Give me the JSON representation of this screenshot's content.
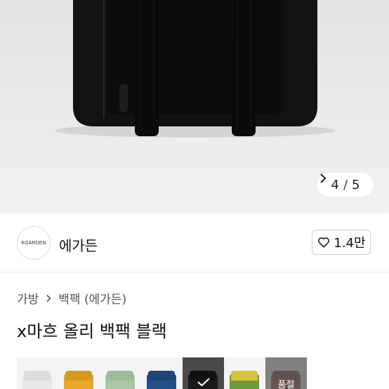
{
  "gallery": {
    "current": "4",
    "separator": "/",
    "total": "5",
    "next_icon": "chevron-right-icon"
  },
  "seller": {
    "logo_text": "EGARDEN",
    "name": "에가든",
    "like_count": "1.4만",
    "like_icon": "heart-outline-icon"
  },
  "breadcrumb": {
    "items": [
      "가방",
      "백팩 (에가든)"
    ],
    "separator_icon": "chevron-right-icon"
  },
  "product": {
    "title": "x마흐 올리 백팩 블랙"
  },
  "swatches": [
    {
      "name": "white",
      "color": "#e8e8e8",
      "flap": "#dcdcdc",
      "selected": false,
      "sold_out": false
    },
    {
      "name": "yellow",
      "color": "#e8a826",
      "flap": "#d49a20",
      "selected": false,
      "sold_out": false
    },
    {
      "name": "mint",
      "color": "#a9c9a6",
      "flap": "#9cbd99",
      "selected": false,
      "sold_out": false
    },
    {
      "name": "navy",
      "color": "#24508a",
      "flap": "#1f4476",
      "selected": false,
      "sold_out": false
    },
    {
      "name": "black",
      "color": "#1a1a1a",
      "flap": "#111111",
      "selected": true,
      "sold_out": false
    },
    {
      "name": "olive",
      "color": "#6f9a3c",
      "flap": "#d8c23a",
      "selected": false,
      "sold_out": false
    },
    {
      "name": "brown",
      "color": "#8a4a35",
      "flap": "#7a3e2c",
      "selected": false,
      "sold_out": true,
      "sold_label": "품절"
    }
  ]
}
